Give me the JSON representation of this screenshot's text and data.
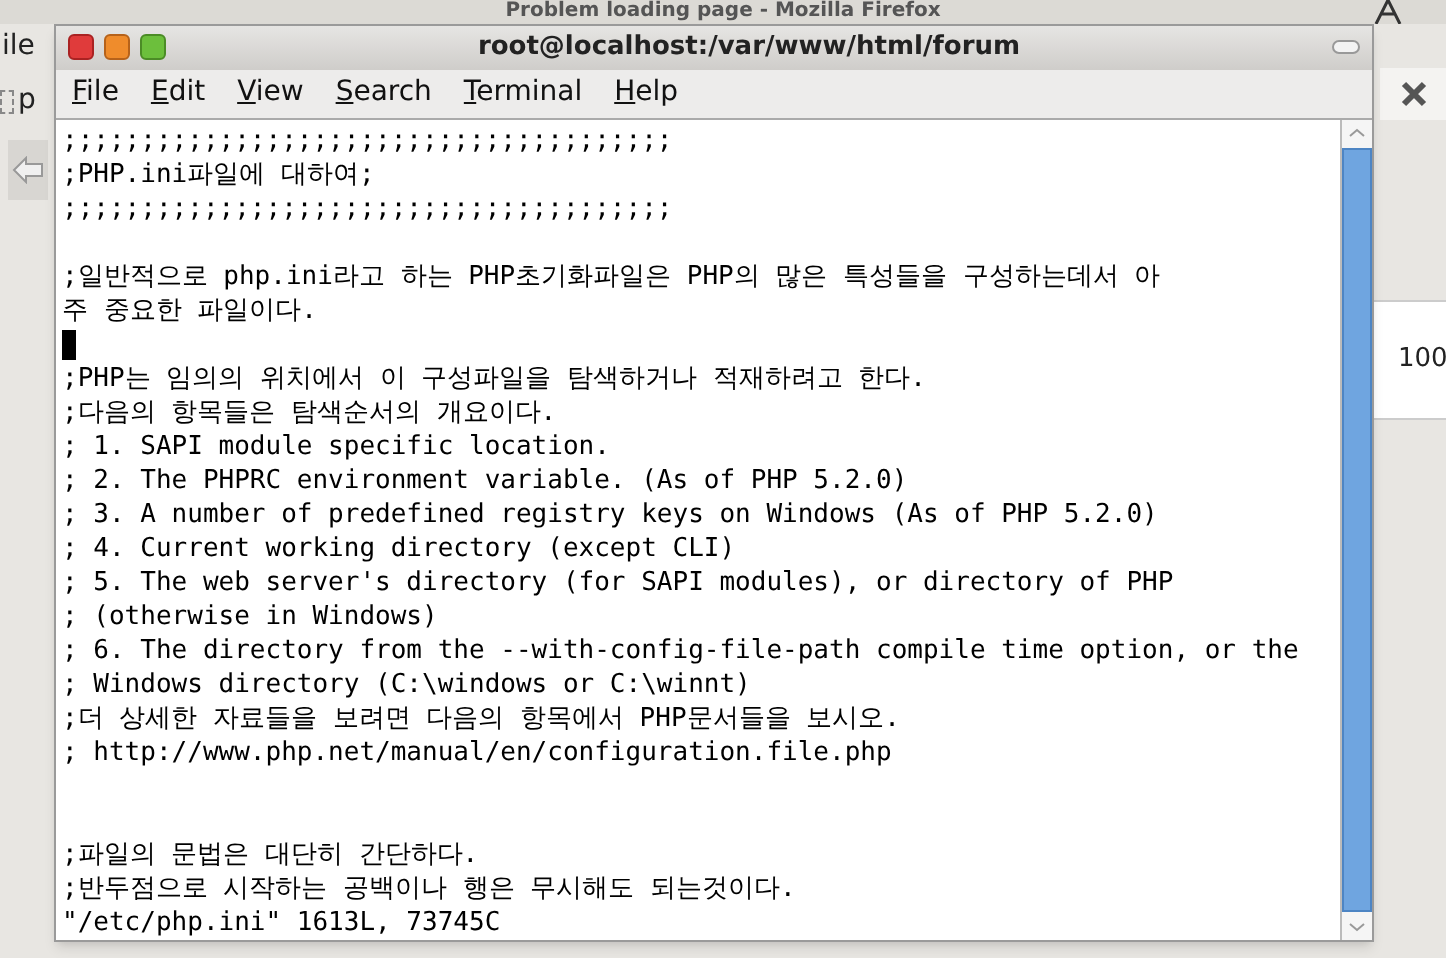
{
  "background_window": {
    "title": "Problem loading page - Mozilla Firefox",
    "menu_fragment": "ile",
    "tab_fragment": "p",
    "zoom_fragment": "100"
  },
  "terminal": {
    "title": "root@localhost:/var/www/html/forum",
    "menu": [
      "File",
      "Edit",
      "View",
      "Search",
      "Terminal",
      "Help"
    ],
    "rows": [
      {
        "kind": "text",
        "text": ";;;;;;;;;;;;;;;;;;;;;;;;;;;;;;;;;;;;;;;"
      },
      {
        "kind": "text",
        "text": ";PHP.ini파일에 대하여;"
      },
      {
        "kind": "text",
        "text": ";;;;;;;;;;;;;;;;;;;;;;;;;;;;;;;;;;;;;;;"
      },
      {
        "kind": "blank"
      },
      {
        "kind": "text",
        "text": ";일반적으로 php.ini라고 하는 PHP초기화파일은 PHP의 많은 특성들을 구성하는데서 아"
      },
      {
        "kind": "text",
        "text": "주 중요한 파일이다."
      },
      {
        "kind": "cursor"
      },
      {
        "kind": "text",
        "text": ";PHP는 임의의 위치에서 이 구성파일을 탐색하거나 적재하려고 한다."
      },
      {
        "kind": "text",
        "text": ";다음의 항목들은 탐색순서의 개요이다."
      },
      {
        "kind": "text",
        "text": "; 1. SAPI module specific location."
      },
      {
        "kind": "text",
        "text": "; 2. The PHPRC environment variable. (As of PHP 5.2.0)"
      },
      {
        "kind": "text",
        "text": "; 3. A number of predefined registry keys on Windows (As of PHP 5.2.0)"
      },
      {
        "kind": "text",
        "text": "; 4. Current working directory (except CLI)"
      },
      {
        "kind": "text",
        "text": "; 5. The web server's directory (for SAPI modules), or directory of PHP"
      },
      {
        "kind": "text",
        "text": "; (otherwise in Windows)"
      },
      {
        "kind": "text",
        "text": "; 6. The directory from the --with-config-file-path compile time option, or the"
      },
      {
        "kind": "text",
        "text": "; Windows directory (C:\\windows or C:\\winnt)"
      },
      {
        "kind": "text",
        "text": ";더 상세한 자료들을 보려면 다음의 항목에서 PHP문서들을 보시오."
      },
      {
        "kind": "text",
        "text": "; http://www.php.net/manual/en/configuration.file.php"
      },
      {
        "kind": "blank"
      },
      {
        "kind": "blank"
      },
      {
        "kind": "text",
        "text": ";파일의 문법은 대단히 간단하다."
      },
      {
        "kind": "text",
        "text": ";반두점으로 시작하는 공백이나 행은 무시해도 되는것이다."
      },
      {
        "kind": "text",
        "text": "\"/etc/php.ini\" 1613L, 73745C"
      }
    ]
  }
}
